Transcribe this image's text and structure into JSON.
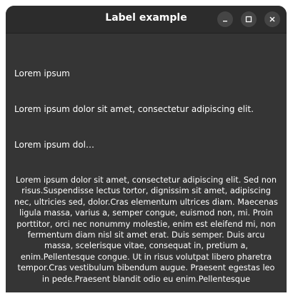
{
  "window": {
    "title": "Label example"
  },
  "labels": {
    "short": "Lorem ipsum",
    "sentence": "Lorem ipsum dolor sit amet, consectetur adipiscing elit.",
    "ellipsized": "Lorem ipsum dol…",
    "wrapped": "Lorem ipsum dolor sit amet, consectetur adipiscing elit. Sed non risus.Suspendisse lectus tortor, dignissim sit amet, adipiscing nec, ultricies sed, dolor.Cras elementum ultrices diam. Maecenas ligula massa, varius a, semper congue, euismod non, mi. Proin porttitor, orci nec nonummy molestie, enim est eleifend mi, non fermentum diam nisl sit amet erat. Duis semper. Duis arcu massa, scelerisque vitae, consequat in, pretium a, enim.Pellentesque congue. Ut in risus volutpat libero pharetra tempor.Cras vestibulum bibendum augue. Praesent egestas leo in pede.Praesent blandit odio eu enim.Pellentesque"
  },
  "icons": {
    "minimize": "minimize-icon",
    "maximize": "maximize-icon",
    "close": "close-icon"
  }
}
